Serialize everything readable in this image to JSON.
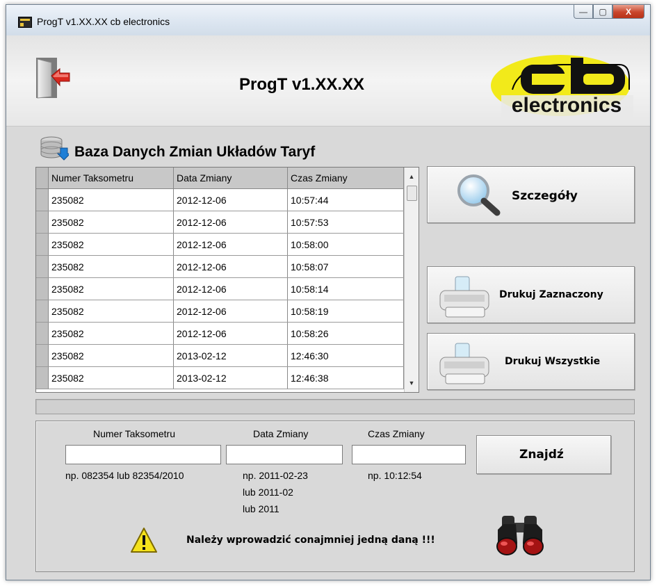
{
  "window": {
    "title": "ProgT v1.XX.XX  cb electronics",
    "caption_buttons": {
      "minimize": "—",
      "maximize": "▢",
      "close": "X"
    }
  },
  "header": {
    "app_title": "ProgT v1.XX.XX",
    "logo_text": "electronics",
    "exit_icon": "exit-door-icon"
  },
  "database": {
    "title": "Baza Danych Zmian Układów Taryf",
    "icon": "database-icon",
    "columns": [
      "Numer Taksometru",
      "Data Zmiany",
      "Czas Zmiany"
    ],
    "rows": [
      [
        "235082",
        "2012-12-06",
        "10:57:44"
      ],
      [
        "235082",
        "2012-12-06",
        "10:57:53"
      ],
      [
        "235082",
        "2012-12-06",
        "10:58:00"
      ],
      [
        "235082",
        "2012-12-06",
        "10:58:07"
      ],
      [
        "235082",
        "2012-12-06",
        "10:58:14"
      ],
      [
        "235082",
        "2012-12-06",
        "10:58:19"
      ],
      [
        "235082",
        "2012-12-06",
        "10:58:26"
      ],
      [
        "235082",
        "2013-02-12",
        "12:46:30"
      ],
      [
        "235082",
        "2013-02-12",
        "12:46:38"
      ]
    ]
  },
  "actions": {
    "details": "Szczegóły",
    "print_selected": "Drukuj Zaznaczony",
    "print_all": "Drukuj Wszystkie"
  },
  "search": {
    "taximeter_label": "Numer Taksometru",
    "taximeter_value": "",
    "taximeter_hint": "np.  082354  lub 82354/2010",
    "date_label": "Data Zmiany",
    "date_value": "",
    "date_hint_1": "np.  2011-02-23",
    "date_hint_2": "lub  2011-02",
    "date_hint_3": "lub  2011",
    "time_label": "Czas Zmiany",
    "time_value": "",
    "time_hint": "np.  10:12:54",
    "find_button": "Znajdź",
    "warning": "Należy wprowadzić conajmniej jedną daną !!!"
  },
  "colors": {
    "logo_yellow": "#f2ea1a",
    "exit_arrow": "#d9281e",
    "close_button": "#c9452b"
  }
}
